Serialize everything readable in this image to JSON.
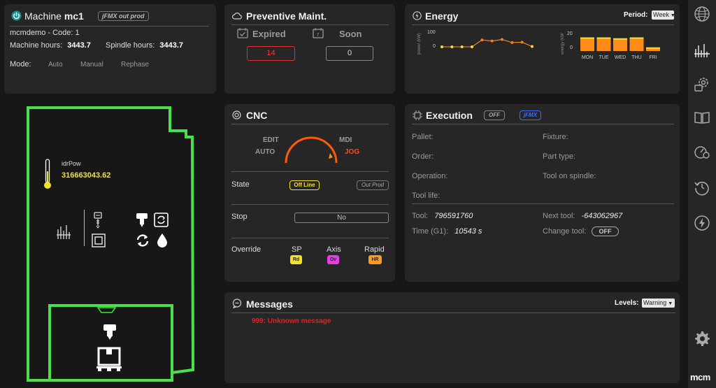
{
  "machine": {
    "title_prefix": "Machine",
    "name": "mc1",
    "badge": "jFMX out prod",
    "code_line": "mcmdemo - Code: 1",
    "machine_hours_label": "Machine hours:",
    "machine_hours": "3443.7",
    "spindle_hours_label": "Spindle hours:",
    "spindle_hours": "3443.7",
    "mode_label": "Mode:",
    "modes": [
      "Auto",
      "Manual",
      "Rephase"
    ]
  },
  "preventive": {
    "title": "Preventive Maint.",
    "expired_label": "Expired",
    "expired_value": "14",
    "soon_label": "Soon",
    "soon_value": "0"
  },
  "energy": {
    "title": "Energy",
    "period_label": "Period:",
    "period_value": "Week",
    "power_axis": "power (kW)",
    "energy_axis": "energy (kW",
    "power_ticks": [
      "100",
      "0"
    ],
    "energy_ticks": [
      "20",
      "0"
    ],
    "days": [
      "MON",
      "TUE",
      "WED",
      "THU",
      "FRI"
    ]
  },
  "chart_data": [
    {
      "type": "line",
      "ylabel": "power (kW)",
      "ylim": [
        0,
        100
      ],
      "x": [
        1,
        2,
        3,
        4,
        5,
        6,
        7,
        8,
        9,
        10
      ],
      "series": [
        {
          "values": [
            0,
            0,
            0,
            0,
            45,
            38,
            48,
            28,
            30,
            2
          ]
        }
      ]
    },
    {
      "type": "bar",
      "ylabel": "energy (kW",
      "ylim": [
        0,
        20
      ],
      "categories": [
        "MON",
        "TUE",
        "WED",
        "THU",
        "FRI"
      ],
      "values": [
        15,
        15,
        14,
        15,
        4
      ]
    }
  ],
  "cnc": {
    "title": "CNC",
    "edit": "EDIT",
    "auto": "AUTO",
    "mdi": "MDI",
    "jog": "JOG",
    "state_label": "State",
    "state_value": "Off Line",
    "state_badge": "Out Prod",
    "stop_label": "Stop",
    "stop_value": "No",
    "override_label": "Override",
    "sp_label": "SP",
    "sp_value": "Rd",
    "axis_label": "Axis",
    "axis_value": "Ov",
    "rapid_label": "Rapid",
    "rapid_value": "HR"
  },
  "execution": {
    "title": "Execution",
    "status_badge": "OFF",
    "jfmx_badge": "jFMX",
    "pallet": "Pallet:",
    "fixture": "Fixture:",
    "order": "Order:",
    "part_type": "Part type:",
    "operation": "Operation:",
    "tool_on_spindle": "Tool on spindle:",
    "tool_life": "Tool life:",
    "tool_label": "Tool:",
    "tool_value": "796591760",
    "next_tool_label": "Next tool:",
    "next_tool_value": "-643062967",
    "time_label": "Time (G1):",
    "time_value": "10543 s",
    "change_tool_label": "Change tool:",
    "change_tool_value": "OFF"
  },
  "messages": {
    "title": "Messages",
    "levels_label": "Levels:",
    "levels_value": "Warning",
    "items": [
      "999: Unknown message"
    ]
  },
  "machine_view": {
    "sensor_name": "idrPow",
    "sensor_value": "316663043.62"
  },
  "logo": "mcm",
  "colors": {
    "accent_green": "#4be04b",
    "alert_red": "#ff2a2a",
    "energy_orange": "#ff8c1a",
    "badge_yellow": "#f5e12a",
    "override_magenta": "#e83ce8",
    "override_orange": "#ff9a1a",
    "jfmx_blue": "#3b6cff"
  }
}
